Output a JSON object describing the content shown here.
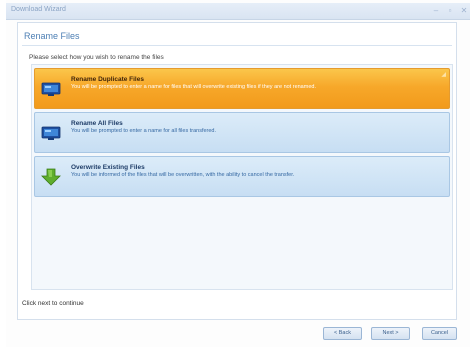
{
  "window": {
    "title": "Download Wizard",
    "controls": [
      "–",
      "▫",
      "✕"
    ]
  },
  "page": {
    "title": "Rename Files",
    "instruction": "Please select how you wish to rename the files"
  },
  "options": [
    {
      "title": "Rename Duplicate Files",
      "description": "You will be prompted to enter a name for files that will overwrite existing files if they are not renamed.",
      "icon": "monitor-icon",
      "selected": true
    },
    {
      "title": "Rename All Files",
      "description": "You will be prompted to enter a name for all files transfered.",
      "icon": "monitor-icon",
      "selected": false
    },
    {
      "title": "Overwrite Existing Files",
      "description": "You will be informed of the files that will be overwritten, with the ability to cancel the transfer.",
      "icon": "download-arrow-icon",
      "selected": false
    }
  ],
  "footer": {
    "hint": "Click next to continue",
    "back_label": "< Back",
    "next_label": "Next >",
    "cancel_label": "Cancel"
  },
  "colors": {
    "selected_gradient_top": "#fbc64b",
    "selected_gradient_bottom": "#f29a1b",
    "option_gradient_top": "#dcecf9",
    "option_gradient_bottom": "#c7def3",
    "accent_text": "#4d7fb4"
  }
}
